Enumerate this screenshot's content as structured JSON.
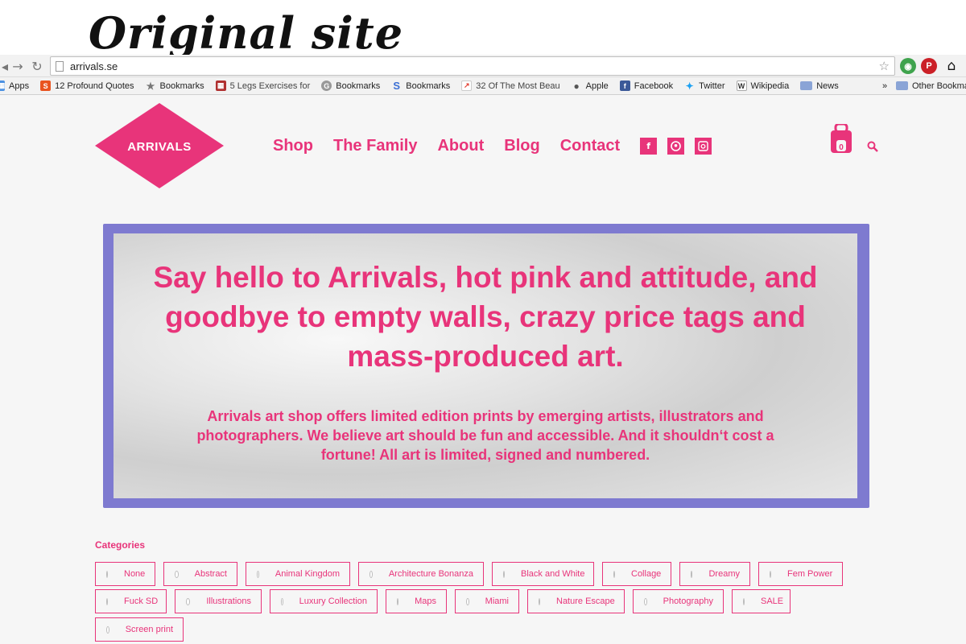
{
  "annotation": "Original site",
  "browser": {
    "url": "arrivals.se",
    "bookmarks": [
      {
        "label": "Apps",
        "icon": "apps-icon",
        "color": "#4a90e2"
      },
      {
        "label": "12 Profound Quotes",
        "icon": "s-icon",
        "color": "#e95420"
      },
      {
        "label": "Bookmarks",
        "icon": "star-icon",
        "color": "#888888"
      },
      {
        "label": "5 Legs Exercises for",
        "icon": "grid-icon",
        "color": "#b03030"
      },
      {
        "label": "Bookmarks",
        "icon": "g-icon",
        "color": "#888888"
      },
      {
        "label": "Bookmarks",
        "icon": "swirl-icon",
        "color": "#3b6fd4"
      },
      {
        "label": "32 Of The Most Beau",
        "icon": "trend-icon",
        "color": "#e23b2e"
      },
      {
        "label": "Apple",
        "icon": "apple-icon",
        "color": "#555555"
      },
      {
        "label": "Facebook",
        "icon": "facebook-icon",
        "color": "#3b5998"
      },
      {
        "label": "Twitter",
        "icon": "twitter-icon",
        "color": "#1da1f2"
      },
      {
        "label": "Wikipedia",
        "icon": "wikipedia-icon",
        "color": "#333333"
      },
      {
        "label": "News",
        "icon": "folder-icon",
        "color": "#8aa4d6"
      }
    ],
    "more": "»",
    "other_bookmarks": "Other Bookmarks"
  },
  "site": {
    "logo_text": "ARRIVALS",
    "nav": [
      "Shop",
      "The Family",
      "About",
      "Blog",
      "Contact"
    ],
    "social": [
      {
        "icon": "facebook-icon",
        "glyph": "f"
      },
      {
        "icon": "pinterest-icon",
        "glyph": "℗"
      },
      {
        "icon": "instagram-icon",
        "glyph": "◘"
      }
    ],
    "cart_count": "0"
  },
  "hero": {
    "title": "Say hello to Arrivals, hot pink and attitude, and goodbye to empty walls, crazy price tags and mass-produced art.",
    "subtitle": "Arrivals art shop offers limited edition prints by emerging artists, illustrators and photographers. We believe art should be fun and accessible. And it shouldn‘t cost a fortune! All art is limited, signed and numbered."
  },
  "categories": {
    "heading": "Categories",
    "rows": [
      [
        "None",
        "Abstract",
        "Animal Kingdom",
        "Architecture Bonanza",
        "Black and White",
        "Collage",
        "Dreamy",
        "Fem Power"
      ],
      [
        "Fuck SD",
        "Illustrations",
        "Luxury Collection",
        "Maps",
        "Miami",
        "Nature Escape",
        "Photography",
        "SALE"
      ],
      [
        "Screen print"
      ]
    ]
  },
  "colors": {
    "accent": "#e8347a",
    "hero_border": "#7e7ad0"
  }
}
